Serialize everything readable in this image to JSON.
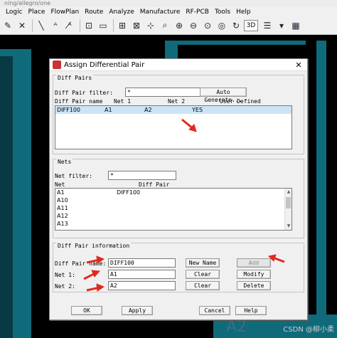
{
  "app": {
    "path": "ning/allegro/one",
    "menu": [
      "Logic",
      "Place",
      "FlowPlan",
      "Route",
      "Analyze",
      "Manufacture",
      "RF-PCB",
      "Tools",
      "Help"
    ],
    "toolbar_view_label": "3D"
  },
  "canvas": {
    "text": "A2",
    "watermark": "CSDN @柳小柔"
  },
  "dialog": {
    "title": "Assign Differential Pair",
    "diff_pairs": {
      "group_label": "Diff Pairs",
      "filter_label": "Diff Pair filter:",
      "filter_value": "*",
      "auto_generate_label": "Auto Generate...",
      "columns": [
        "Diff Pair name",
        "Net 1",
        "Net 2",
        "User Defined"
      ],
      "rows": [
        {
          "name": "DIFF100",
          "net1": "A1",
          "net2": "A2",
          "user_defined": "YES"
        }
      ]
    },
    "nets": {
      "group_label": "Nets",
      "filter_label": "Net filter:",
      "filter_value": "*",
      "columns": [
        "Net",
        "Diff Pair"
      ],
      "rows": [
        {
          "net": "A1",
          "diff_pair": "DIFF100"
        },
        {
          "net": "A10",
          "diff_pair": ""
        },
        {
          "net": "A11",
          "diff_pair": ""
        },
        {
          "net": "A12",
          "diff_pair": ""
        },
        {
          "net": "A13",
          "diff_pair": ""
        }
      ]
    },
    "info": {
      "group_label": "Diff Pair information",
      "name_label": "Diff Pair name:",
      "name_value": "DIFF100",
      "net1_label": "Net 1:",
      "net1_value": "A1",
      "net2_label": "Net 2:",
      "net2_value": "A2",
      "new_name_label": "New Name",
      "add_label": "Add",
      "clear1_label": "Clear",
      "modify_label": "Modify",
      "clear2_label": "Clear",
      "delete_label": "Delete"
    },
    "footer": {
      "ok_label": "OK",
      "apply_label": "Apply",
      "cancel_label": "Cancel",
      "help_label": "Help"
    }
  },
  "colors": {
    "annotation_arrow": "#e02a1e",
    "selection": "#cce4f7",
    "board_teal": "#0f6a7a"
  }
}
